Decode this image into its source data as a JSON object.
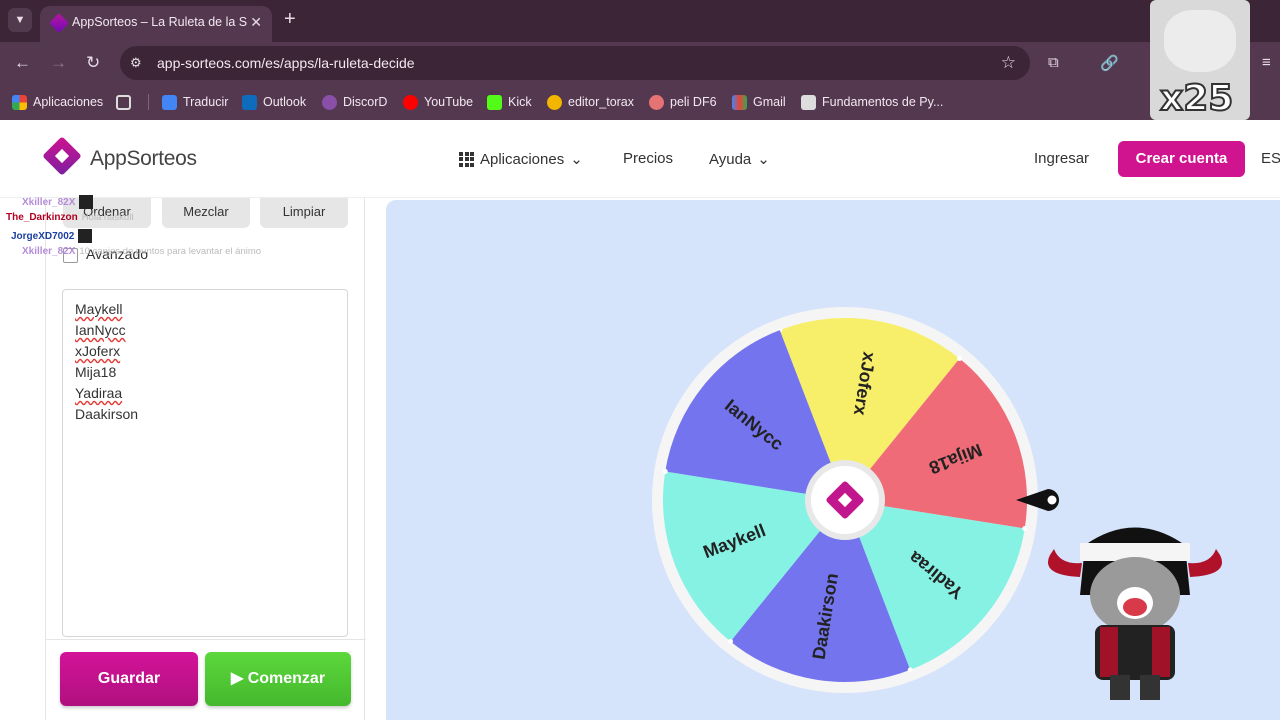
{
  "browser": {
    "tab_title": "AppSorteos – La Ruleta de la Su",
    "tab_close": "✕",
    "new_tab": "+",
    "url": "app-sorteos.com/es/apps/la-ruleta-decide",
    "bookmarks": [
      "Aplicaciones",
      "Traducir",
      "Outlook",
      "DiscorD",
      "YouTube",
      "Kick",
      "editor_torax",
      "peli DF6",
      "Gmail",
      "Fundamentos de Py..."
    ]
  },
  "header": {
    "logo": "AppSorteos",
    "nav": [
      "Aplicaciones",
      "Precios",
      "Ayuda"
    ],
    "login": "Ingresar",
    "signup": "Crear cuenta",
    "lang": "ES"
  },
  "panel": {
    "buttons": [
      "Ordenar",
      "Mezclar",
      "Limpiar"
    ],
    "advanced_label": "Avanzado",
    "entries": [
      "Maykell",
      "IanNycc",
      "xJoferx",
      "Mija18",
      "Yadiraa",
      "Daakirson"
    ],
    "save": "Guardar",
    "start": "Comenzar"
  },
  "chat": [
    {
      "user": "Xkiller_82X",
      "text": "",
      "color": "#b48cd8"
    },
    {
      "user": "The_Darkinzon",
      "text": "Hola haskull",
      "color": "#b00020"
    },
    {
      "user": "JorgeXD7002",
      "text": "",
      "color": "#1a3fa0"
    },
    {
      "user": "Xkiller_82X",
      "text": "10 canjes de puntos para levantar el ánimo",
      "color": "#b48cd8"
    }
  ],
  "overlay": {
    "emote_count": "x25"
  },
  "wheel": {
    "segments": [
      {
        "label": "xJoferx",
        "color": "#f7ef6a"
      },
      {
        "label": "Mija18",
        "color": "#f06b78"
      },
      {
        "label": "Yadiraa",
        "color": "#86f2e4"
      },
      {
        "label": "Daakirson",
        "color": "#7474ef"
      },
      {
        "label": "Maykell",
        "color": "#86f2e4"
      },
      {
        "label": "IanNycc",
        "color": "#7474ef"
      }
    ]
  }
}
